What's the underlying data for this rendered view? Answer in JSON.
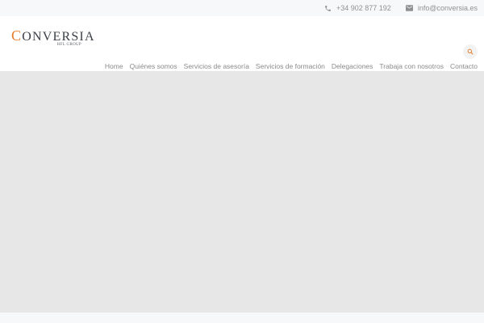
{
  "topbar": {
    "phone": {
      "icon": "phone-icon",
      "text": "+34 902 877 192"
    },
    "email": {
      "icon": "mail-icon",
      "text": "info@conversia.es"
    }
  },
  "logo": {
    "initial": "C",
    "name": "ONVERSIA",
    "sub": "HFL GROUP"
  },
  "search": {
    "icon": "search-icon"
  },
  "nav": {
    "items": [
      "Home",
      "Quiénes somos",
      "Servicios de asesoría",
      "Servicios de formación",
      "Delegaciones",
      "Trabaja con nosotros",
      "Contacto"
    ]
  },
  "colors": {
    "accent": "#e57d2b",
    "hero_bg": "#e7e7e7",
    "topbar_bg": "#f7f8fa"
  }
}
